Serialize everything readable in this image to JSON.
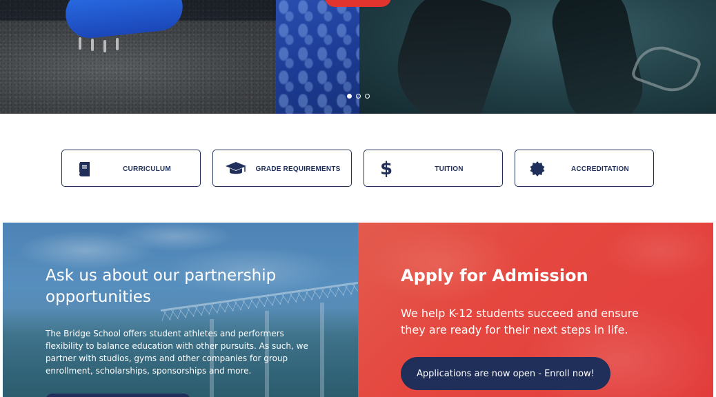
{
  "colors": {
    "navy": "#1f2f5a",
    "accent_red": "#e2342e",
    "white": "#ffffff"
  },
  "hero": {
    "slides_count": 3,
    "active_slide": 1
  },
  "features": [
    {
      "label": "CURRICULUM",
      "icon": "book-icon"
    },
    {
      "label": "GRADE REQUIREMENTS",
      "icon": "graduation-cap-icon"
    },
    {
      "label": "TUITION",
      "icon": "dollar-icon"
    },
    {
      "label": "ACCREDITATION",
      "icon": "badge-icon"
    }
  ],
  "partnership": {
    "title": "Ask us about our partnership opportunities",
    "body": "The Bridge School offers student athletes and performers flexibility to balance education with other pursuits. As such, we partner with studios, gyms and other companies for group enrollment, scholarships, sponsorships and more."
  },
  "admission": {
    "title": "Apply for Admission",
    "body": "We help K-12 students succeed and ensure they are ready for their next steps in life.",
    "cta": "Applications are now open - Enroll now!"
  },
  "icons": {
    "dollar_glyph": "$"
  }
}
